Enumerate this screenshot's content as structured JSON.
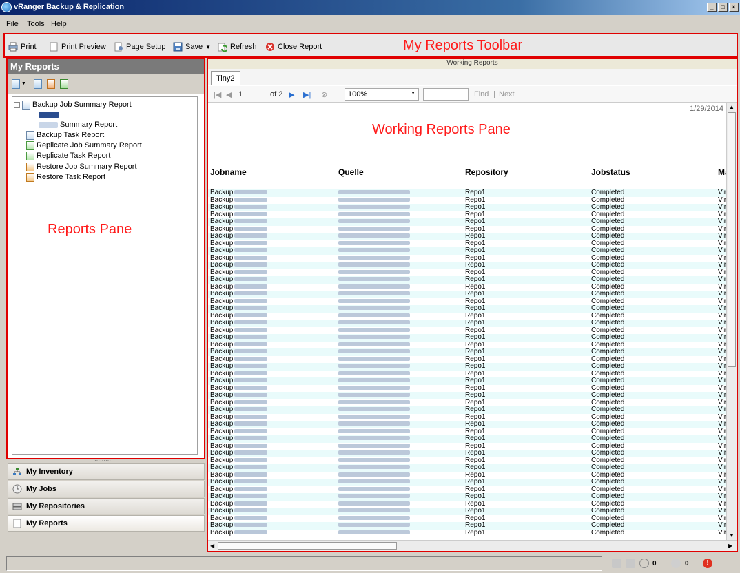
{
  "window": {
    "title": "vRanger Backup & Replication"
  },
  "menu": [
    "File",
    "Tools",
    "Help"
  ],
  "toolbar": {
    "items": [
      "Print",
      "Print Preview",
      "Page Setup",
      "Save",
      "Refresh",
      "Close Report"
    ],
    "callout": "My Reports Toolbar"
  },
  "reports_pane": {
    "title": "My Reports",
    "callout": "Reports Pane",
    "tree": [
      "Backup Job Summary Report",
      "Summary Report",
      "Backup Task Report",
      "Replicate Job Summary Report",
      "Replicate Task Report",
      "Restore Job Summary Report",
      "Restore Task Report"
    ]
  },
  "nav": [
    "My Inventory",
    "My Jobs",
    "My Repositories",
    "My Reports"
  ],
  "working_pane": {
    "title": "Working Reports",
    "tab": "Tiny2",
    "callout": "Working Reports Pane",
    "page_current": "1",
    "page_of": "of 2",
    "zoom": "100%",
    "find": "Find",
    "next": "Next",
    "date": "1/29/2014",
    "columns": [
      "Jobname",
      "Quelle",
      "Repository",
      "Jobstatus",
      "Ma"
    ],
    "row_template": {
      "jobname": "Backup",
      "repository": "Repo1",
      "status": "Completed",
      "ma": "Virtu"
    },
    "row_count": 48
  },
  "status": {
    "count1": "0",
    "count2": "0"
  },
  "colors": {
    "callout": "#ff1a1a",
    "alt_row": "#e9fbfb",
    "pane_border": "#e00000"
  }
}
